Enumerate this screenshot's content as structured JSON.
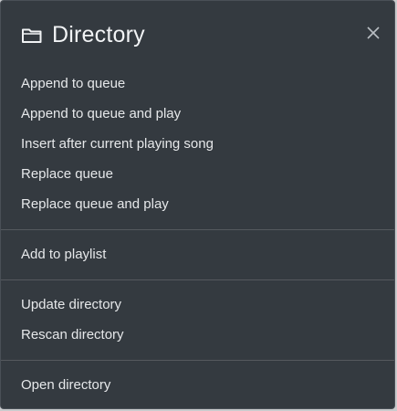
{
  "dialog": {
    "title": "Directory",
    "title_icon": "folder-icon",
    "close_icon": "close-icon"
  },
  "menu": {
    "groups": [
      {
        "items": [
          {
            "label": "Append to queue"
          },
          {
            "label": "Append to queue and play"
          },
          {
            "label": "Insert after current playing song"
          },
          {
            "label": "Replace queue"
          },
          {
            "label": "Replace queue and play"
          }
        ]
      },
      {
        "items": [
          {
            "label": "Add to playlist"
          }
        ]
      },
      {
        "items": [
          {
            "label": "Update directory"
          },
          {
            "label": "Rescan directory"
          }
        ]
      },
      {
        "items": [
          {
            "label": "Open directory"
          }
        ]
      }
    ]
  },
  "colors": {
    "background": "#343a40",
    "text": "#e6e8ea",
    "separator": "#55595e"
  }
}
